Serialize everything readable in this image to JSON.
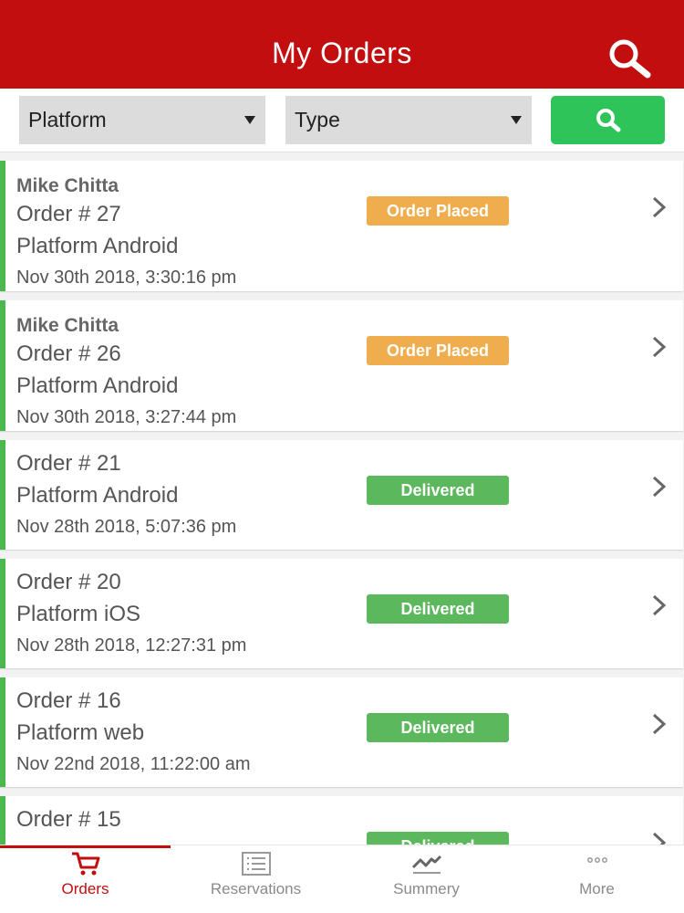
{
  "header": {
    "title": "My Orders",
    "search_icon": "search-icon"
  },
  "filters": {
    "platform_label": "Platform",
    "type_label": "Type",
    "search_icon": "search-icon"
  },
  "orders": [
    {
      "customer": "Mike Chitta",
      "order": "Order # 27",
      "platform": "Platform Android",
      "date": "Nov 30th 2018, 3:30:16 pm",
      "status": "Order Placed"
    },
    {
      "customer": "Mike Chitta",
      "order": "Order # 26",
      "platform": "Platform Android",
      "date": "Nov 30th 2018, 3:27:44 pm",
      "status": "Order Placed"
    },
    {
      "order": "Order # 21",
      "platform": "Platform Android",
      "date": "Nov 28th 2018, 5:07:36 pm",
      "status": "Delivered"
    },
    {
      "order": "Order # 20",
      "platform": "Platform iOS",
      "date": "Nov 28th 2018, 12:27:31 pm",
      "status": "Delivered"
    },
    {
      "order": "Order # 16",
      "platform": "Platform web",
      "date": "Nov 22nd 2018, 11:22:00 am",
      "status": "Delivered"
    },
    {
      "order": "Order # 15",
      "status": "Delivered"
    }
  ],
  "tabs": [
    {
      "label": "Orders",
      "icon": "cart-icon",
      "active": true
    },
    {
      "label": "Reservations",
      "icon": "list-icon",
      "active": false
    },
    {
      "label": "Summery",
      "icon": "trend-icon",
      "active": false
    },
    {
      "label": "More",
      "icon": "more-icon",
      "active": false
    }
  ],
  "colors": {
    "brand_red": "#c20e0e",
    "search_green": "#2fc45a",
    "placed_orange": "#f0ad4e",
    "delivered_green": "#5cb85c",
    "card_accent": "#4ab84e"
  }
}
